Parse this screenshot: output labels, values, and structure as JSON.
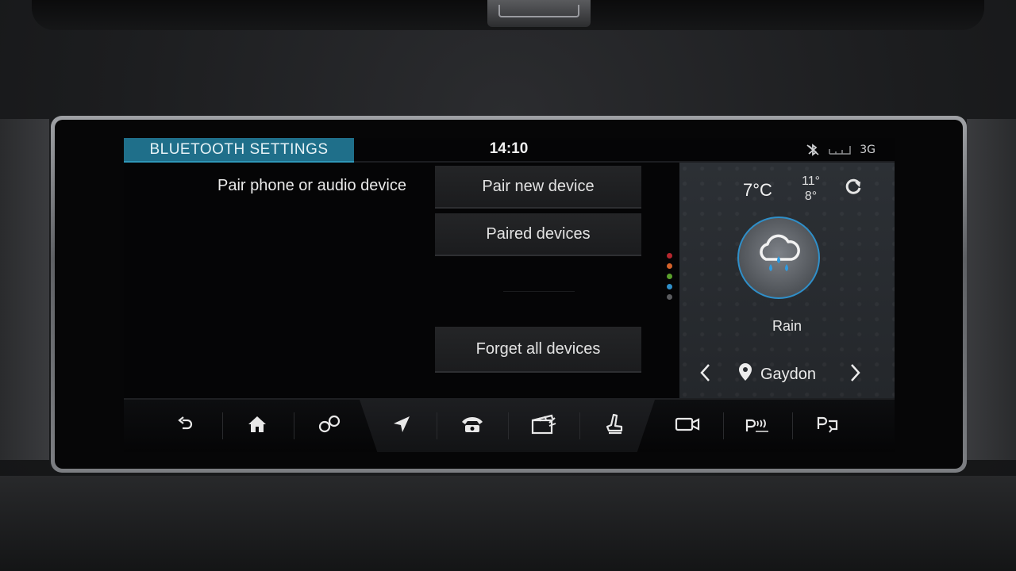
{
  "header": {
    "title": "BLUETOOTH SETTINGS",
    "time": "14:10",
    "network": "3G"
  },
  "bluetooth": {
    "section_label": "Pair phone or audio device",
    "pair_new_label": "Pair new device",
    "paired_label": "Paired devices",
    "forget_all_label": "Forget all devices"
  },
  "page_indicator": {
    "dot_colors": [
      "#b5272e",
      "#d4622a",
      "#5aa02c",
      "#2f8fc9",
      "#5a5b5e"
    ]
  },
  "weather": {
    "temperature": "7°C",
    "high": "11°",
    "low": "8°",
    "condition": "Rain",
    "location": "Gaydon",
    "icon": "cloud-rain-icon"
  },
  "navbar": {
    "items": [
      "back-icon",
      "home-icon",
      "connect-icon",
      "navigation-icon",
      "phone-icon",
      "media-icon",
      "seat-icon",
      "camera-icon",
      "park-assist-icon",
      "park-exit-icon"
    ]
  },
  "colors": {
    "accent": "#1f6f8a",
    "highlight": "#2f8fc9"
  }
}
